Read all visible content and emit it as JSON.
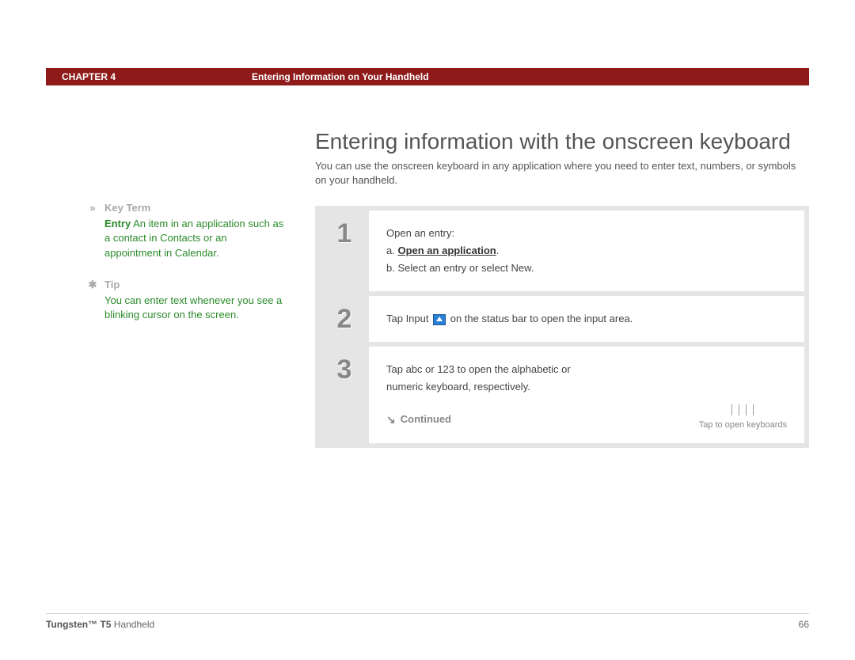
{
  "header": {
    "chapter": "CHAPTER 4",
    "title": "Entering Information on Your Handheld"
  },
  "heading": "Entering information with the onscreen keyboard",
  "intro": "You can use the onscreen keyboard in any application where you need to enter text, numbers, or symbols on your handheld.",
  "sidebar": {
    "keyterm": {
      "symbol": "»",
      "label": "Key Term",
      "term": "Entry",
      "text": "An item in an application such as a contact in Contacts or an appointment in Calendar."
    },
    "tip": {
      "symbol": "✱",
      "label": "Tip",
      "text": "You can enter text whenever you see a blinking cursor on the screen."
    }
  },
  "steps": {
    "s1": {
      "num": "1",
      "line1": "Open an entry:",
      "a_prefix": "a.",
      "a_link": "Open an application",
      "a_suffix": ".",
      "b": "b.  Select an entry or select New."
    },
    "s2": {
      "num": "2",
      "pre": "Tap Input ",
      "post": " on the status bar to open the input area."
    },
    "s3": {
      "num": "3",
      "text": "Tap abc or 123 to open the alphabetic or numeric keyboard, respectively.",
      "continued": "Continued",
      "tap_caption": "Tap to open keyboards"
    }
  },
  "footer": {
    "product_bold": "Tungsten™ T5",
    "product_rest": " Handheld",
    "page": "66"
  }
}
